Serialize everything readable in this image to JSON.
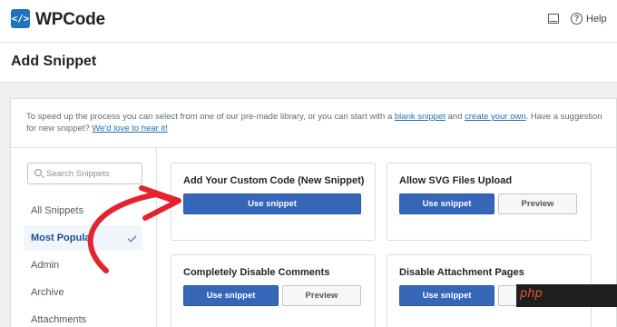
{
  "app": {
    "logo_mark": "</>",
    "name": "WPCode",
    "help_label": "Help"
  },
  "header": {
    "title": "Add Snippet"
  },
  "intro": {
    "text_before": "To speed up the process you can select from one of our pre-made library, or you can start with a ",
    "blank_link": "blank snippet",
    "text_and": " and ",
    "own_link": "create your own",
    "text_mid": ". Have a suggestion for new snippet? ",
    "love_link": "We'd love to hear it!"
  },
  "search": {
    "placeholder": "Search Snippets",
    "value": ""
  },
  "categories": [
    {
      "label": "All Snippets",
      "active": false
    },
    {
      "label": "Most Popular",
      "active": true
    },
    {
      "label": "Admin",
      "active": false
    },
    {
      "label": "Archive",
      "active": false
    },
    {
      "label": "Attachments",
      "active": false
    }
  ],
  "snippets": [
    {
      "title": "Add Your Custom Code (New Snippet)",
      "use_label": "Use snippet",
      "preview_label": ""
    },
    {
      "title": "Allow SVG Files Upload",
      "use_label": "Use snippet",
      "preview_label": "Preview"
    },
    {
      "title": "Completely Disable Comments",
      "use_label": "Use snippet",
      "preview_label": "Preview"
    },
    {
      "title": "Disable Attachment Pages",
      "use_label": "Use snippet",
      "preview_label": "Preview"
    }
  ],
  "watermark": "php",
  "colors": {
    "brand": "#1e73be",
    "primary_button": "#3566b8",
    "annotation_arrow": "#e4232e"
  }
}
